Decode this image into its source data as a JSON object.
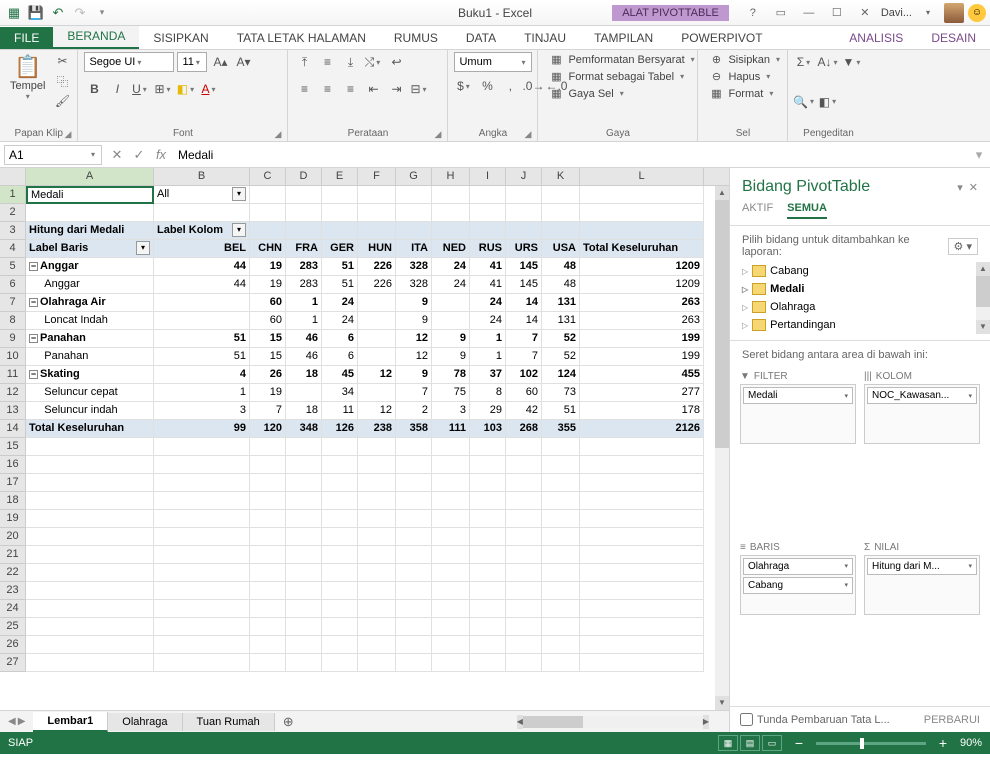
{
  "title": "Buku1 - Excel",
  "pivot_tools": "ALAT PIVOTTABLE",
  "user": "Davi...",
  "tabs": {
    "file": "FILE",
    "list": [
      "BERANDA",
      "SISIPKAN",
      "TATA LETAK HALAMAN",
      "RUMUS",
      "DATA",
      "TINJAU",
      "TAMPILAN",
      "POWERPIVOT"
    ],
    "ctx": [
      "ANALISIS",
      "DESAIN"
    ]
  },
  "ribbon": {
    "clipboard": {
      "label": "Papan Klip",
      "paste": "Tempel"
    },
    "font": {
      "label": "Font",
      "name": "Segoe UI",
      "size": "11"
    },
    "align": {
      "label": "Perataan"
    },
    "number": {
      "label": "Angka",
      "format": "Umum"
    },
    "styles": {
      "label": "Gaya",
      "cond": "Pemformatan Bersyarat",
      "table": "Format sebagai Tabel",
      "cell": "Gaya Sel"
    },
    "cells": {
      "label": "Sel",
      "insert": "Sisipkan",
      "delete": "Hapus",
      "format": "Format"
    },
    "editing": {
      "label": "Pengeditan"
    }
  },
  "formula": {
    "cell": "A1",
    "value": "Medali"
  },
  "columns": [
    "A",
    "B",
    "C",
    "D",
    "E",
    "F",
    "G",
    "H",
    "I",
    "J",
    "K",
    "L"
  ],
  "pivot": {
    "r1": {
      "medal": "Medali",
      "all": "All"
    },
    "r3": {
      "count": "Hitung dari Medali",
      "collabel": "Label Kolom"
    },
    "r4_label": "Label Baris",
    "cols": [
      "BEL",
      "CHN",
      "FRA",
      "GER",
      "HUN",
      "ITA",
      "NED",
      "RUS",
      "URS",
      "USA",
      "Total Keseluruhan"
    ],
    "rows": [
      {
        "n": 5,
        "type": "group",
        "label": "Anggar",
        "v": [
          "44",
          "19",
          "283",
          "51",
          "226",
          "328",
          "24",
          "41",
          "145",
          "48",
          "1209"
        ]
      },
      {
        "n": 6,
        "type": "item",
        "label": "Anggar",
        "v": [
          "44",
          "19",
          "283",
          "51",
          "226",
          "328",
          "24",
          "41",
          "145",
          "48",
          "1209"
        ]
      },
      {
        "n": 7,
        "type": "group",
        "label": "Olahraga Air",
        "v": [
          "",
          "60",
          "1",
          "24",
          "",
          "9",
          "",
          "24",
          "14",
          "131",
          "263"
        ]
      },
      {
        "n": 8,
        "type": "item",
        "label": "Loncat Indah",
        "v": [
          "",
          "60",
          "1",
          "24",
          "",
          "9",
          "",
          "24",
          "14",
          "131",
          "263"
        ]
      },
      {
        "n": 9,
        "type": "group",
        "label": "Panahan",
        "v": [
          "51",
          "15",
          "46",
          "6",
          "",
          "12",
          "9",
          "1",
          "7",
          "52",
          "199"
        ]
      },
      {
        "n": 10,
        "type": "item",
        "label": "Panahan",
        "v": [
          "51",
          "15",
          "46",
          "6",
          "",
          "12",
          "9",
          "1",
          "7",
          "52",
          "199"
        ]
      },
      {
        "n": 11,
        "type": "group",
        "label": "Skating",
        "v": [
          "4",
          "26",
          "18",
          "45",
          "12",
          "9",
          "78",
          "37",
          "102",
          "124",
          "455"
        ]
      },
      {
        "n": 12,
        "type": "item",
        "label": "Seluncur cepat",
        "v": [
          "1",
          "19",
          "",
          "34",
          "",
          "7",
          "75",
          "8",
          "60",
          "73",
          "277"
        ]
      },
      {
        "n": 13,
        "type": "item",
        "label": "Seluncur indah",
        "v": [
          "3",
          "7",
          "18",
          "11",
          "12",
          "2",
          "3",
          "29",
          "42",
          "51",
          "178"
        ]
      }
    ],
    "grand": {
      "label": "Total Keseluruhan",
      "v": [
        "99",
        "120",
        "348",
        "126",
        "238",
        "358",
        "111",
        "103",
        "268",
        "355",
        "2126"
      ]
    }
  },
  "sheets": {
    "active": "Lembar1",
    "others": [
      "Olahraga",
      "Tuan Rumah"
    ]
  },
  "field_pane": {
    "title": "Bidang PivotTable",
    "tabs": {
      "active": "AKTIF",
      "all": "SEMUA"
    },
    "hint": "Pilih bidang untuk ditambahkan ke laporan:",
    "fields": [
      "Cabang",
      "Medali",
      "Olahraga",
      "Pertandingan"
    ],
    "drag_hint": "Seret bidang antara area di bawah ini:",
    "areas": {
      "filter": {
        "title": "FILTER",
        "items": [
          "Medali"
        ]
      },
      "columns": {
        "title": "KOLOM",
        "items": [
          "NOC_Kawasan..."
        ]
      },
      "rows": {
        "title": "BARIS",
        "items": [
          "Olahraga",
          "Cabang"
        ]
      },
      "values": {
        "title": "NILAI",
        "items": [
          "Hitung dari M..."
        ]
      }
    },
    "defer": "Tunda Pembaruan Tata L...",
    "update": "PERBARUI"
  },
  "status": {
    "ready": "SIAP",
    "zoom": "90%"
  }
}
